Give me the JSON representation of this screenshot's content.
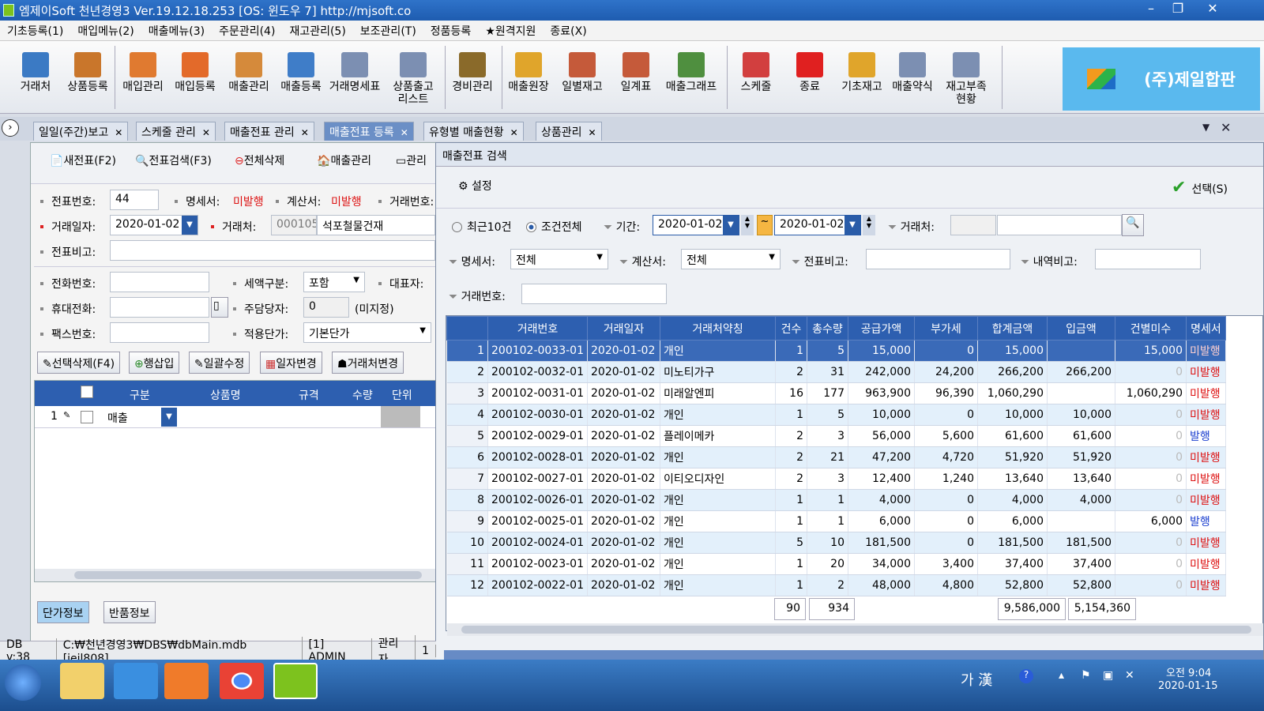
{
  "window": {
    "title": "엠제이Soft 천년경영3  Ver.19.12.18.253  [OS: 윈도우 7]    http://mjsoft.co",
    "min": "–",
    "max": "❐",
    "close": "✕"
  },
  "menu": [
    "기초등록(1)",
    "매입메뉴(2)",
    "매출메뉴(3)",
    "주문관리(4)",
    "재고관리(5)",
    "보조관리(T)",
    "정품등록",
    "★원격지원",
    "종료(X)"
  ],
  "toolbar": [
    {
      "label": "거래처",
      "icon": "client-icon",
      "color": "#3b7ac4"
    },
    {
      "label": "상품등록",
      "icon": "product-icon",
      "color": "#c9762b"
    },
    {
      "label": "매입관리",
      "icon": "purchase-manage-icon",
      "color": "#e07a30"
    },
    {
      "label": "매입등록",
      "icon": "purchase-register-icon",
      "color": "#e36a2a"
    },
    {
      "label": "매출관리",
      "icon": "sales-manage-icon",
      "color": "#d58a3b"
    },
    {
      "label": "매출등록",
      "icon": "sales-register-icon",
      "color": "#3f7dc8"
    },
    {
      "label": "거래명세표",
      "icon": "statement-icon",
      "color": "#7c8fb2"
    },
    {
      "label": "상품출고\n리스트",
      "icon": "shipping-list-icon",
      "color": "#7c8fb2"
    },
    {
      "label": "경비관리",
      "icon": "expense-icon",
      "color": "#8a6a2a"
    },
    {
      "label": "매출원장",
      "icon": "sales-ledger-icon",
      "color": "#e0a52b"
    },
    {
      "label": "일별재고",
      "icon": "daily-stock-icon",
      "color": "#c55a3a"
    },
    {
      "label": "일계표",
      "icon": "daily-report-icon",
      "color": "#c55a3a"
    },
    {
      "label": "매출그래프",
      "icon": "sales-graph-icon",
      "color": "#4f8f3f"
    },
    {
      "label": "스케줄",
      "icon": "schedule-icon",
      "color": "#d23f3f"
    },
    {
      "label": "종료",
      "icon": "power-icon",
      "color": "#e02020"
    },
    {
      "label": "기초재고",
      "icon": "base-stock-icon",
      "color": "#e0a52b"
    },
    {
      "label": "매출약식",
      "icon": "sales-simple-icon",
      "color": "#7c8fb2"
    },
    {
      "label": "재고부족\n현황",
      "icon": "stock-shortage-icon",
      "color": "#7c8fb2"
    }
  ],
  "brand": {
    "name": "(주)제일합판"
  },
  "tabs": [
    {
      "label": "일일(주간)보고",
      "active": false
    },
    {
      "label": "스케줄 관리",
      "active": false
    },
    {
      "label": "매출전표 관리",
      "active": false
    },
    {
      "label": "매출전표 등록",
      "active": true
    },
    {
      "label": "유형별 매출현황",
      "active": false
    },
    {
      "label": "상품관리",
      "active": false
    }
  ],
  "left": {
    "buttons": {
      "new": "새전표(F2)",
      "search": "전표검색(F3)",
      "delete_all": "전체삭제",
      "sales_manage": "매출관리",
      "more": "관리"
    },
    "labels": {
      "slip_no": "전표번호:",
      "statement": "명세서:",
      "invoice": "계산서:",
      "trade_no": "거래번호:",
      "trade_date": "거래일자:",
      "client": "거래처:",
      "remark": "전표비고:",
      "phone": "전화번호:",
      "tax_type": "세액구분:",
      "rep": "대표자:",
      "mobile": "휴대전화:",
      "manager": "주담당자:",
      "fax": "팩스번호:",
      "unit_price": "적용단가:"
    },
    "values": {
      "slip_no": "44",
      "statement": "미발행",
      "invoice": "미발행",
      "trade_date": "2020-01-02",
      "client_code": "000105",
      "client_name": "석포철물건재",
      "tax_type": "포함",
      "manager_code": "0",
      "manager_name": "(미지정)",
      "unit_price": "기본단가"
    },
    "actions": {
      "del_sel": "선택삭제(F4)",
      "insert": "행삽입",
      "bulk": "일괄수정",
      "date_change": "일자변경",
      "client_change": "거래처변경"
    },
    "grid_headers": [
      "구분",
      "상품명",
      "규격",
      "수량",
      "단위"
    ],
    "grid_row": {
      "no": "1",
      "type": "매출"
    },
    "bottom_tabs": [
      "단가정보",
      "반품정보"
    ]
  },
  "right": {
    "title": "매출전표 검색",
    "settings": "설정",
    "select": "선택(S)",
    "radio": {
      "recent": "최근10건",
      "all": "조건전체"
    },
    "filters": {
      "period": "기간:",
      "date_from": "2020-01-02",
      "date_to": "2020-01-02",
      "client": "거래처:",
      "statement": "명세서:",
      "statement_val": "전체",
      "invoice": "계산서:",
      "invoice_val": "전체",
      "remark": "전표비고:",
      "detail_remark": "내역비고:",
      "trade_no": "거래번호:"
    },
    "columns": [
      "거래번호",
      "거래일자",
      "거래처약칭",
      "건수",
      "총수량",
      "공급가액",
      "부가세",
      "합계금액",
      "입금액",
      "건별미수",
      "명세서"
    ],
    "rows": [
      [
        "1",
        "200102-0033-01",
        "2020-01-02",
        "개인",
        "1",
        "5",
        "15,000",
        "0",
        "15,000",
        "",
        "15,000",
        "미발행"
      ],
      [
        "2",
        "200102-0032-01",
        "2020-01-02",
        "미노티가구",
        "2",
        "31",
        "242,000",
        "24,200",
        "266,200",
        "266,200",
        "0",
        "미발행"
      ],
      [
        "3",
        "200102-0031-01",
        "2020-01-02",
        "미래알엔피",
        "16",
        "177",
        "963,900",
        "96,390",
        "1,060,290",
        "",
        "1,060,290",
        "미발행"
      ],
      [
        "4",
        "200102-0030-01",
        "2020-01-02",
        "개인",
        "1",
        "5",
        "10,000",
        "0",
        "10,000",
        "10,000",
        "0",
        "미발행"
      ],
      [
        "5",
        "200102-0029-01",
        "2020-01-02",
        "플레이메카",
        "2",
        "3",
        "56,000",
        "5,600",
        "61,600",
        "61,600",
        "0",
        "발행"
      ],
      [
        "6",
        "200102-0028-01",
        "2020-01-02",
        "개인",
        "2",
        "21",
        "47,200",
        "4,720",
        "51,920",
        "51,920",
        "0",
        "미발행"
      ],
      [
        "7",
        "200102-0027-01",
        "2020-01-02",
        "이티오디자인",
        "2",
        "3",
        "12,400",
        "1,240",
        "13,640",
        "13,640",
        "0",
        "미발행"
      ],
      [
        "8",
        "200102-0026-01",
        "2020-01-02",
        "개인",
        "1",
        "1",
        "4,000",
        "0",
        "4,000",
        "4,000",
        "0",
        "미발행"
      ],
      [
        "9",
        "200102-0025-01",
        "2020-01-02",
        "개인",
        "1",
        "1",
        "6,000",
        "0",
        "6,000",
        "",
        "6,000",
        "발행"
      ],
      [
        "10",
        "200102-0024-01",
        "2020-01-02",
        "개인",
        "5",
        "10",
        "181,500",
        "0",
        "181,500",
        "181,500",
        "0",
        "미발행"
      ],
      [
        "11",
        "200102-0023-01",
        "2020-01-02",
        "개인",
        "1",
        "20",
        "34,000",
        "3,400",
        "37,400",
        "37,400",
        "0",
        "미발행"
      ],
      [
        "12",
        "200102-0022-01",
        "2020-01-02",
        "개인",
        "1",
        "2",
        "48,000",
        "4,800",
        "52,800",
        "52,800",
        "0",
        "미발행"
      ]
    ],
    "totals": {
      "count": "90",
      "qty": "934",
      "total": "9,586,000",
      "paid": "5,154,360"
    }
  },
  "status": [
    "DB v:38",
    "C:₩천년경영3₩DBS₩dbMain.mdb [jeil808]",
    "[1] ADMIN",
    "관리자",
    "1"
  ],
  "taskbar": {
    "ime": "가 漢",
    "time": "오전 9:04",
    "date": "2020-01-15"
  }
}
